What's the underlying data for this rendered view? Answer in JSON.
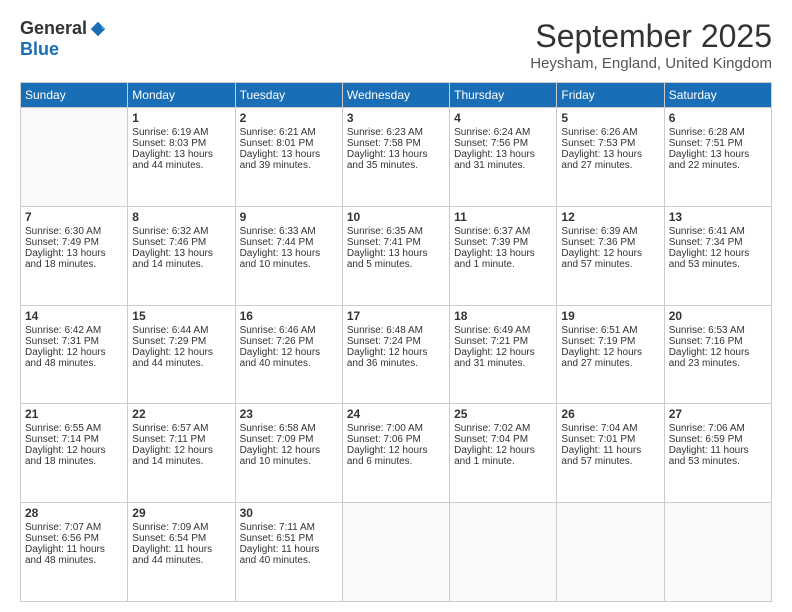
{
  "logo": {
    "general": "General",
    "blue": "Blue"
  },
  "title": "September 2025",
  "location": "Heysham, England, United Kingdom",
  "days": [
    "Sunday",
    "Monday",
    "Tuesday",
    "Wednesday",
    "Thursday",
    "Friday",
    "Saturday"
  ],
  "weeks": [
    [
      {
        "num": "",
        "empty": true
      },
      {
        "num": "1",
        "sunrise": "Sunrise: 6:19 AM",
        "sunset": "Sunset: 8:03 PM",
        "daylight": "Daylight: 13 hours and 44 minutes."
      },
      {
        "num": "2",
        "sunrise": "Sunrise: 6:21 AM",
        "sunset": "Sunset: 8:01 PM",
        "daylight": "Daylight: 13 hours and 39 minutes."
      },
      {
        "num": "3",
        "sunrise": "Sunrise: 6:23 AM",
        "sunset": "Sunset: 7:58 PM",
        "daylight": "Daylight: 13 hours and 35 minutes."
      },
      {
        "num": "4",
        "sunrise": "Sunrise: 6:24 AM",
        "sunset": "Sunset: 7:56 PM",
        "daylight": "Daylight: 13 hours and 31 minutes."
      },
      {
        "num": "5",
        "sunrise": "Sunrise: 6:26 AM",
        "sunset": "Sunset: 7:53 PM",
        "daylight": "Daylight: 13 hours and 27 minutes."
      },
      {
        "num": "6",
        "sunrise": "Sunrise: 6:28 AM",
        "sunset": "Sunset: 7:51 PM",
        "daylight": "Daylight: 13 hours and 22 minutes."
      }
    ],
    [
      {
        "num": "7",
        "sunrise": "Sunrise: 6:30 AM",
        "sunset": "Sunset: 7:49 PM",
        "daylight": "Daylight: 13 hours and 18 minutes."
      },
      {
        "num": "8",
        "sunrise": "Sunrise: 6:32 AM",
        "sunset": "Sunset: 7:46 PM",
        "daylight": "Daylight: 13 hours and 14 minutes."
      },
      {
        "num": "9",
        "sunrise": "Sunrise: 6:33 AM",
        "sunset": "Sunset: 7:44 PM",
        "daylight": "Daylight: 13 hours and 10 minutes."
      },
      {
        "num": "10",
        "sunrise": "Sunrise: 6:35 AM",
        "sunset": "Sunset: 7:41 PM",
        "daylight": "Daylight: 13 hours and 5 minutes."
      },
      {
        "num": "11",
        "sunrise": "Sunrise: 6:37 AM",
        "sunset": "Sunset: 7:39 PM",
        "daylight": "Daylight: 13 hours and 1 minute."
      },
      {
        "num": "12",
        "sunrise": "Sunrise: 6:39 AM",
        "sunset": "Sunset: 7:36 PM",
        "daylight": "Daylight: 12 hours and 57 minutes."
      },
      {
        "num": "13",
        "sunrise": "Sunrise: 6:41 AM",
        "sunset": "Sunset: 7:34 PM",
        "daylight": "Daylight: 12 hours and 53 minutes."
      }
    ],
    [
      {
        "num": "14",
        "sunrise": "Sunrise: 6:42 AM",
        "sunset": "Sunset: 7:31 PM",
        "daylight": "Daylight: 12 hours and 48 minutes."
      },
      {
        "num": "15",
        "sunrise": "Sunrise: 6:44 AM",
        "sunset": "Sunset: 7:29 PM",
        "daylight": "Daylight: 12 hours and 44 minutes."
      },
      {
        "num": "16",
        "sunrise": "Sunrise: 6:46 AM",
        "sunset": "Sunset: 7:26 PM",
        "daylight": "Daylight: 12 hours and 40 minutes."
      },
      {
        "num": "17",
        "sunrise": "Sunrise: 6:48 AM",
        "sunset": "Sunset: 7:24 PM",
        "daylight": "Daylight: 12 hours and 36 minutes."
      },
      {
        "num": "18",
        "sunrise": "Sunrise: 6:49 AM",
        "sunset": "Sunset: 7:21 PM",
        "daylight": "Daylight: 12 hours and 31 minutes."
      },
      {
        "num": "19",
        "sunrise": "Sunrise: 6:51 AM",
        "sunset": "Sunset: 7:19 PM",
        "daylight": "Daylight: 12 hours and 27 minutes."
      },
      {
        "num": "20",
        "sunrise": "Sunrise: 6:53 AM",
        "sunset": "Sunset: 7:16 PM",
        "daylight": "Daylight: 12 hours and 23 minutes."
      }
    ],
    [
      {
        "num": "21",
        "sunrise": "Sunrise: 6:55 AM",
        "sunset": "Sunset: 7:14 PM",
        "daylight": "Daylight: 12 hours and 18 minutes."
      },
      {
        "num": "22",
        "sunrise": "Sunrise: 6:57 AM",
        "sunset": "Sunset: 7:11 PM",
        "daylight": "Daylight: 12 hours and 14 minutes."
      },
      {
        "num": "23",
        "sunrise": "Sunrise: 6:58 AM",
        "sunset": "Sunset: 7:09 PM",
        "daylight": "Daylight: 12 hours and 10 minutes."
      },
      {
        "num": "24",
        "sunrise": "Sunrise: 7:00 AM",
        "sunset": "Sunset: 7:06 PM",
        "daylight": "Daylight: 12 hours and 6 minutes."
      },
      {
        "num": "25",
        "sunrise": "Sunrise: 7:02 AM",
        "sunset": "Sunset: 7:04 PM",
        "daylight": "Daylight: 12 hours and 1 minute."
      },
      {
        "num": "26",
        "sunrise": "Sunrise: 7:04 AM",
        "sunset": "Sunset: 7:01 PM",
        "daylight": "Daylight: 11 hours and 57 minutes."
      },
      {
        "num": "27",
        "sunrise": "Sunrise: 7:06 AM",
        "sunset": "Sunset: 6:59 PM",
        "daylight": "Daylight: 11 hours and 53 minutes."
      }
    ],
    [
      {
        "num": "28",
        "sunrise": "Sunrise: 7:07 AM",
        "sunset": "Sunset: 6:56 PM",
        "daylight": "Daylight: 11 hours and 48 minutes."
      },
      {
        "num": "29",
        "sunrise": "Sunrise: 7:09 AM",
        "sunset": "Sunset: 6:54 PM",
        "daylight": "Daylight: 11 hours and 44 minutes."
      },
      {
        "num": "30",
        "sunrise": "Sunrise: 7:11 AM",
        "sunset": "Sunset: 6:51 PM",
        "daylight": "Daylight: 11 hours and 40 minutes."
      },
      {
        "num": "",
        "empty": true
      },
      {
        "num": "",
        "empty": true
      },
      {
        "num": "",
        "empty": true
      },
      {
        "num": "",
        "empty": true
      }
    ]
  ]
}
